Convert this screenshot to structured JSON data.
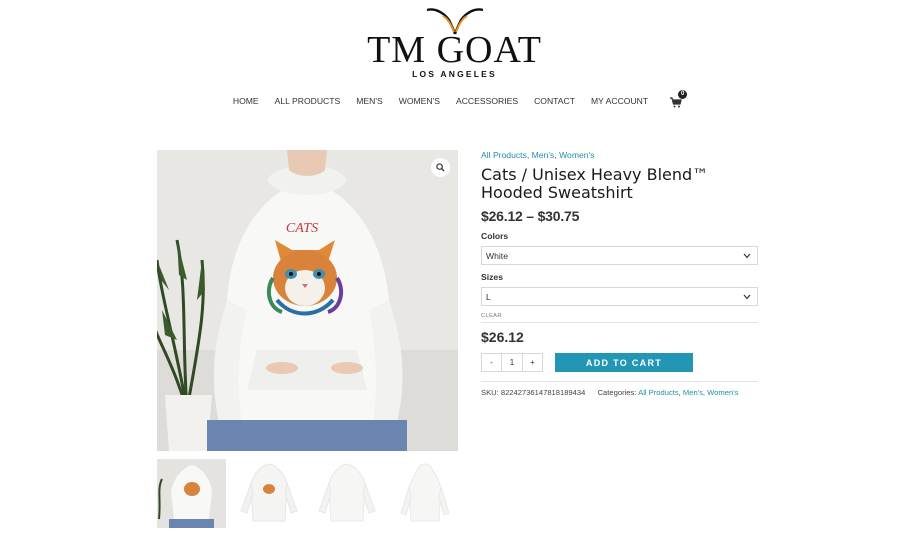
{
  "brand": {
    "name": "TM GOAT",
    "location": "LOS ANGELES"
  },
  "nav": {
    "items": [
      "HOME",
      "ALL PRODUCTS",
      "MEN'S",
      "WOMEN'S",
      "ACCESSORIES",
      "CONTACT",
      "MY ACCOUNT"
    ],
    "cart_count": "0",
    "cart_icon": "cart-icon"
  },
  "product": {
    "categories": [
      "All Products",
      "Men's",
      "Women's"
    ],
    "title": "Cats / Unisex Heavy Blend™ Hooded Sweatshirt",
    "price_range": "$26.12 – $30.75",
    "image_print_text": "CATS",
    "colors_label": "Colors",
    "colors_value": "White",
    "sizes_label": "Sizes",
    "sizes_value": "L",
    "clear_label": "CLEAR",
    "price": "$26.12",
    "qty_minus": "-",
    "qty_value": "1",
    "qty_plus": "+",
    "add_to_cart": "ADD TO CART",
    "sku_label": "SKU:",
    "sku_value": "82242736147818189434",
    "meta_categories_label": "Categories:",
    "thumbnails": [
      "front-model",
      "front-flat",
      "back-flat",
      "back-hood"
    ]
  },
  "colors": {
    "accent": "#2396b6",
    "link": "#1e8fa8"
  }
}
